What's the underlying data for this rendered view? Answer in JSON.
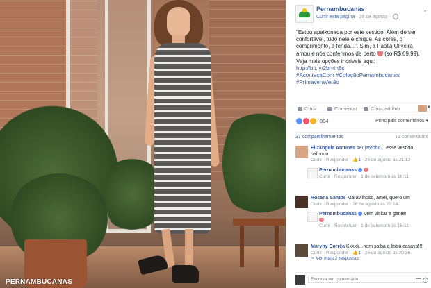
{
  "photo": {
    "watermark": "PERNAMBUCANAS"
  },
  "post": {
    "page_name": "Pernambucanas",
    "like_page": "Curtir esta página",
    "separator": " · ",
    "date": "26 de agosto",
    "menu_icon": "chevron-down-icon",
    "text_lines": [
      "\"Estou apaixonada por este vestido. Além de ser",
      "confortável, tudo nele é chique. As cores, o",
      "comprimento, a fenda...\". Sim, a Paolla Oliveira",
      "amou e nós conferimos de perto"
    ],
    "price": "(só R$ 69,99).",
    "more_options": "Veja mais opções incríveis aqui:",
    "link": "http://bit.ly/2bn4n8c",
    "hashtag_line1": "#AconteçaCom #ColeçãoPernambucanas",
    "hashtag_line2": "#PrimaveraVerão"
  },
  "actions": {
    "like": "Curtir",
    "comment": "Comentar",
    "share": "Compartilhar"
  },
  "reactions": {
    "count": "834",
    "relevant": "Principais comentários ▾",
    "colors": {
      "like": "#5890ff",
      "love": "#f25268",
      "wow": "#f7b125"
    }
  },
  "stats": {
    "shares": "27 compartilhamentos",
    "comments": "16 comentários"
  },
  "comments": [
    {
      "author": "Elizangela Antunes",
      "text_tag": "#eujatenho...",
      "text": " esse vestido bafoooo",
      "actions": "Curtir · Responder · ",
      "likes": "👍1",
      "time": " · 26 de agosto às 21:13",
      "reply": {
        "author": "Pernambucanas",
        "actions": "Curtir · Responder · 1 de setembro às 16:11"
      }
    },
    {
      "author": "Rosana Santos",
      "text": " Maravilhoso, amei, quero um",
      "actions": "Curtir · Responder · 26 de agosto às 23:14",
      "reply": {
        "author": "Pernambucanas",
        "text": " Vem visitar a gente!",
        "actions": "Curtir · Responder · 1 de setembro às 16:11"
      }
    },
    {
      "author": "Maryny Corrêa",
      "text": " Kkkkk...nem saiba q listra casava!!!!",
      "actions": "Curtir · Responder · ",
      "likes": "👍1",
      "time": " · 26 de agosto às 20:36",
      "more_replies": "↪ Ver mais 2 respostas"
    }
  ],
  "write": {
    "placeholder": "Escreva um comentário..."
  }
}
